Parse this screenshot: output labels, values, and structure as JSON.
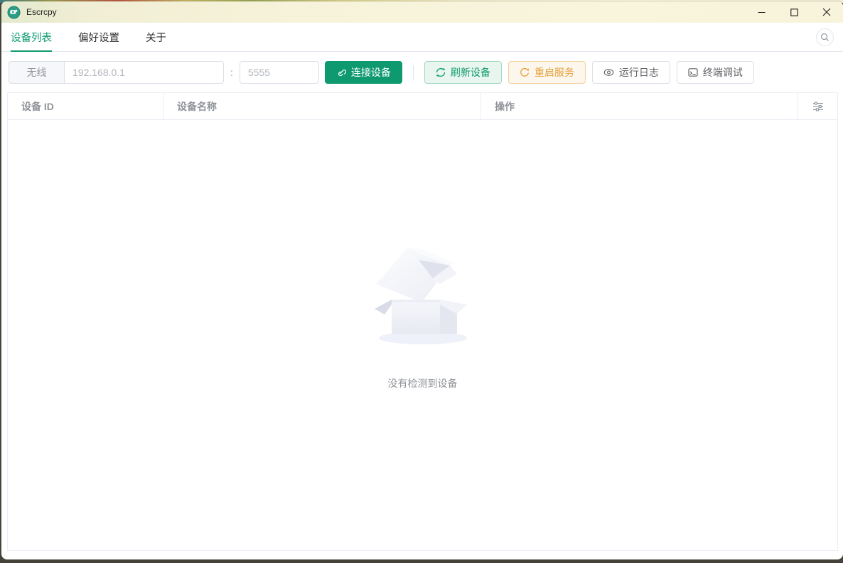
{
  "window": {
    "title": "Escrcpy"
  },
  "tabs": [
    {
      "label": "设备列表",
      "active": true
    },
    {
      "label": "偏好设置",
      "active": false
    },
    {
      "label": "关于",
      "active": false
    }
  ],
  "toolbar": {
    "wireless_label": "无线",
    "ip_placeholder": "192.168.0.1",
    "separator": ":",
    "port_placeholder": "5555",
    "connect_label": "连接设备",
    "refresh_label": "刷新设备",
    "restart_label": "重启服务",
    "logs_label": "运行日志",
    "terminal_label": "终端调试"
  },
  "table": {
    "columns": [
      "设备 ID",
      "设备名称",
      "操作"
    ],
    "rows": []
  },
  "empty": {
    "message": "没有检测到设备"
  },
  "icons": {
    "app": "escrcpy-logo",
    "connect": "link-icon",
    "refresh": "refresh-icon",
    "restart": "restart-arrow-icon",
    "logs": "eye-icon",
    "terminal": "terminal-icon",
    "header_settings": "sliders-icon",
    "search": "magnifier-icon"
  },
  "colors": {
    "primary_green": "#0e9a6e",
    "success_bg": "#e9f6f0",
    "warning_orange": "#e6a23c",
    "warning_bg": "#fdf6ec",
    "titlebar_bg": "#f8f4dc",
    "border": "#ebeef5",
    "muted_text": "#909399"
  }
}
